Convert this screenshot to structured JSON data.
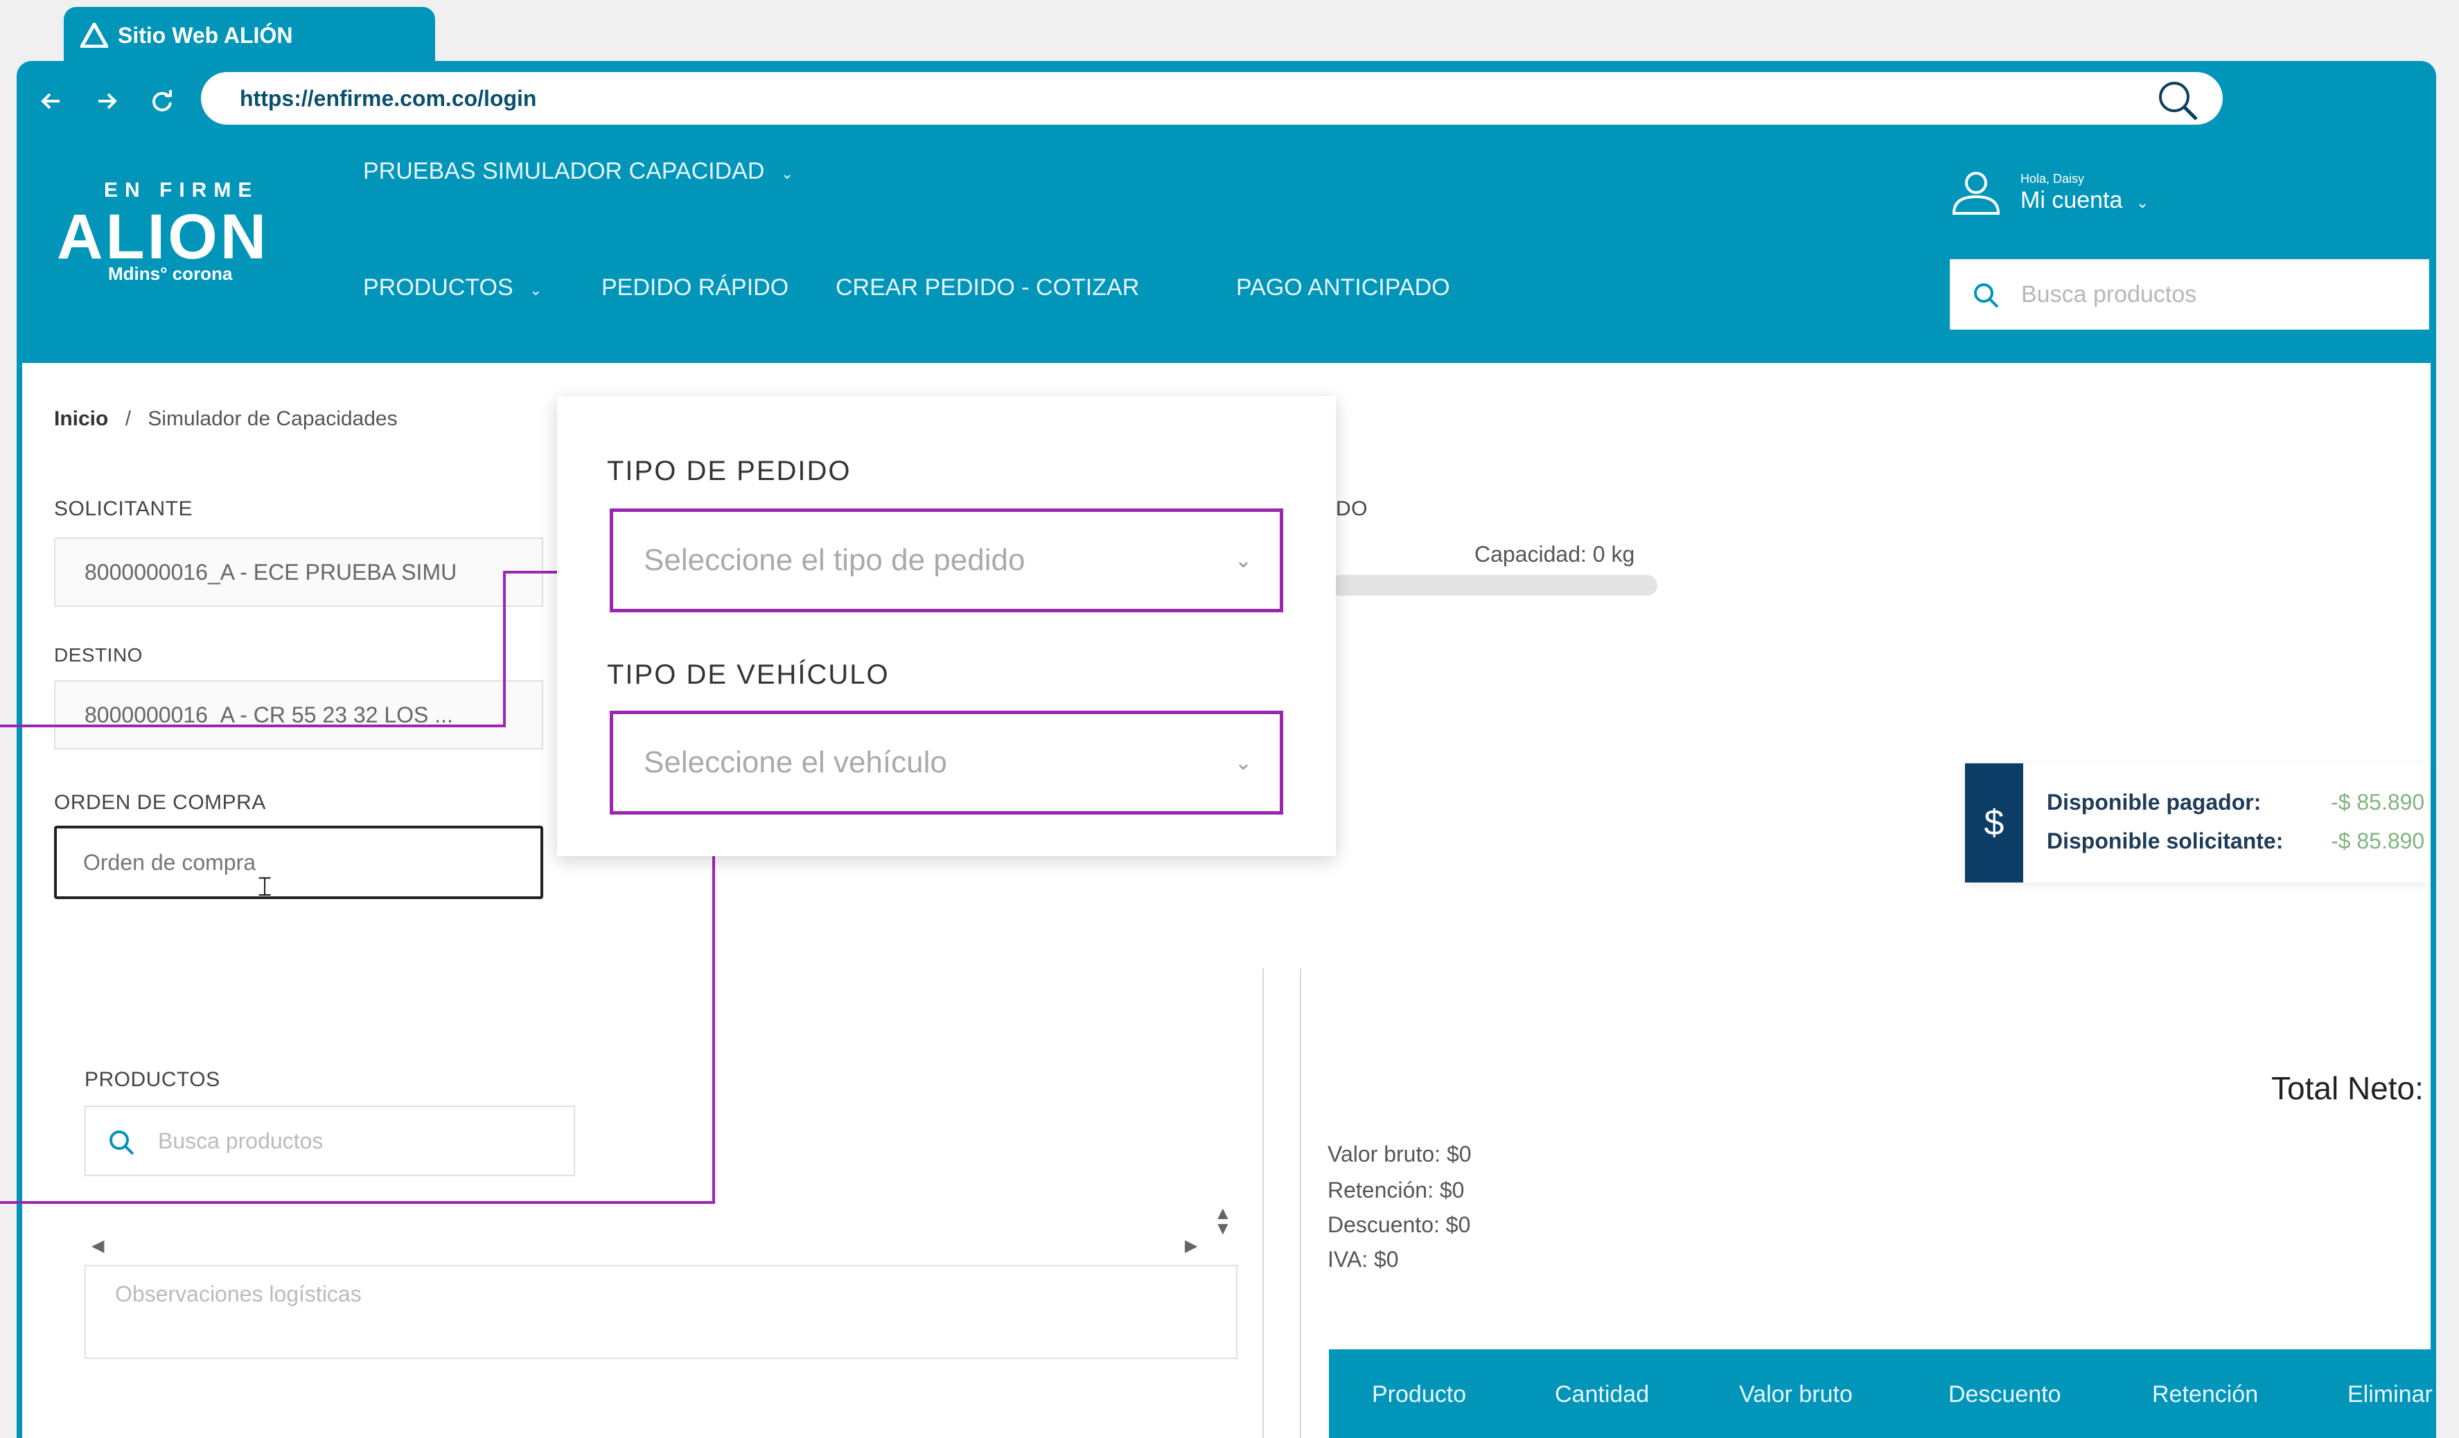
{
  "browser": {
    "tab_title": "Sitio Web ALIÓN",
    "url": "https://enfirme.com.co/login"
  },
  "header": {
    "logo_top": "EN FIRME",
    "logo_main": "ALION",
    "logo_sub": "Mdins° corona",
    "context_select": "PRUEBAS SIMULADOR CAPACIDAD",
    "greeting": "Hola, Daisy",
    "account": "Mi cuenta",
    "nav": [
      "PRODUCTOS",
      "PEDIDO RÁPIDO",
      "CREAR PEDIDO - COTIZAR",
      "PAGO ANTICIPADO"
    ],
    "search_placeholder": "Busca productos"
  },
  "breadcrumb": {
    "home": "Inicio",
    "separator": "/",
    "current": "Simulador de Capacidades"
  },
  "form": {
    "solicitante_label": "SOLICITANTE",
    "solicitante_value": "8000000016_A - ECE PRUEBA SIMU",
    "destino_label": "DESTINO",
    "destino_value": "8000000016_A - CR 55 23 32 LOS ...",
    "orden_label": "ORDEN DE COMPRA",
    "orden_placeholder": "Orden de compra",
    "productos_label": "PRODUCTOS",
    "productos_placeholder": "Busca productos",
    "observaciones_placeholder": "Observaciones logísticas"
  },
  "popup": {
    "tipo_pedido_label": "TIPO DE PEDIDO",
    "tipo_pedido_placeholder": "Seleccione el tipo de pedido",
    "tipo_vehiculo_label": "TIPO DE VEHÍCULO",
    "tipo_vehiculo_placeholder": "Seleccione el vehículo"
  },
  "capacity": {
    "partial_label": "DO",
    "text": "Capacidad:  0  kg",
    "fill_fraction": 0
  },
  "disponible": {
    "icon": "$",
    "pagador_label": "Disponible pagador:",
    "pagador_value": "-$ 85.890",
    "solicitante_label": "Disponible solicitante:",
    "solicitante_value": "-$ 85.890"
  },
  "totals": {
    "total_neto": "Total Neto:",
    "valor_bruto": "Valor bruto: $0",
    "retencion": "Retención: $0",
    "descuento": "Descuento: $0",
    "iva": "IVA: $0"
  },
  "table": {
    "columns": [
      "Producto",
      "Cantidad",
      "Valor bruto",
      "Descuento",
      "Retención",
      "Eliminar"
    ]
  },
  "colors": {
    "brand": "#0095b9",
    "highlight": "#9b27b0",
    "dark_navy": "#0b3d66"
  }
}
